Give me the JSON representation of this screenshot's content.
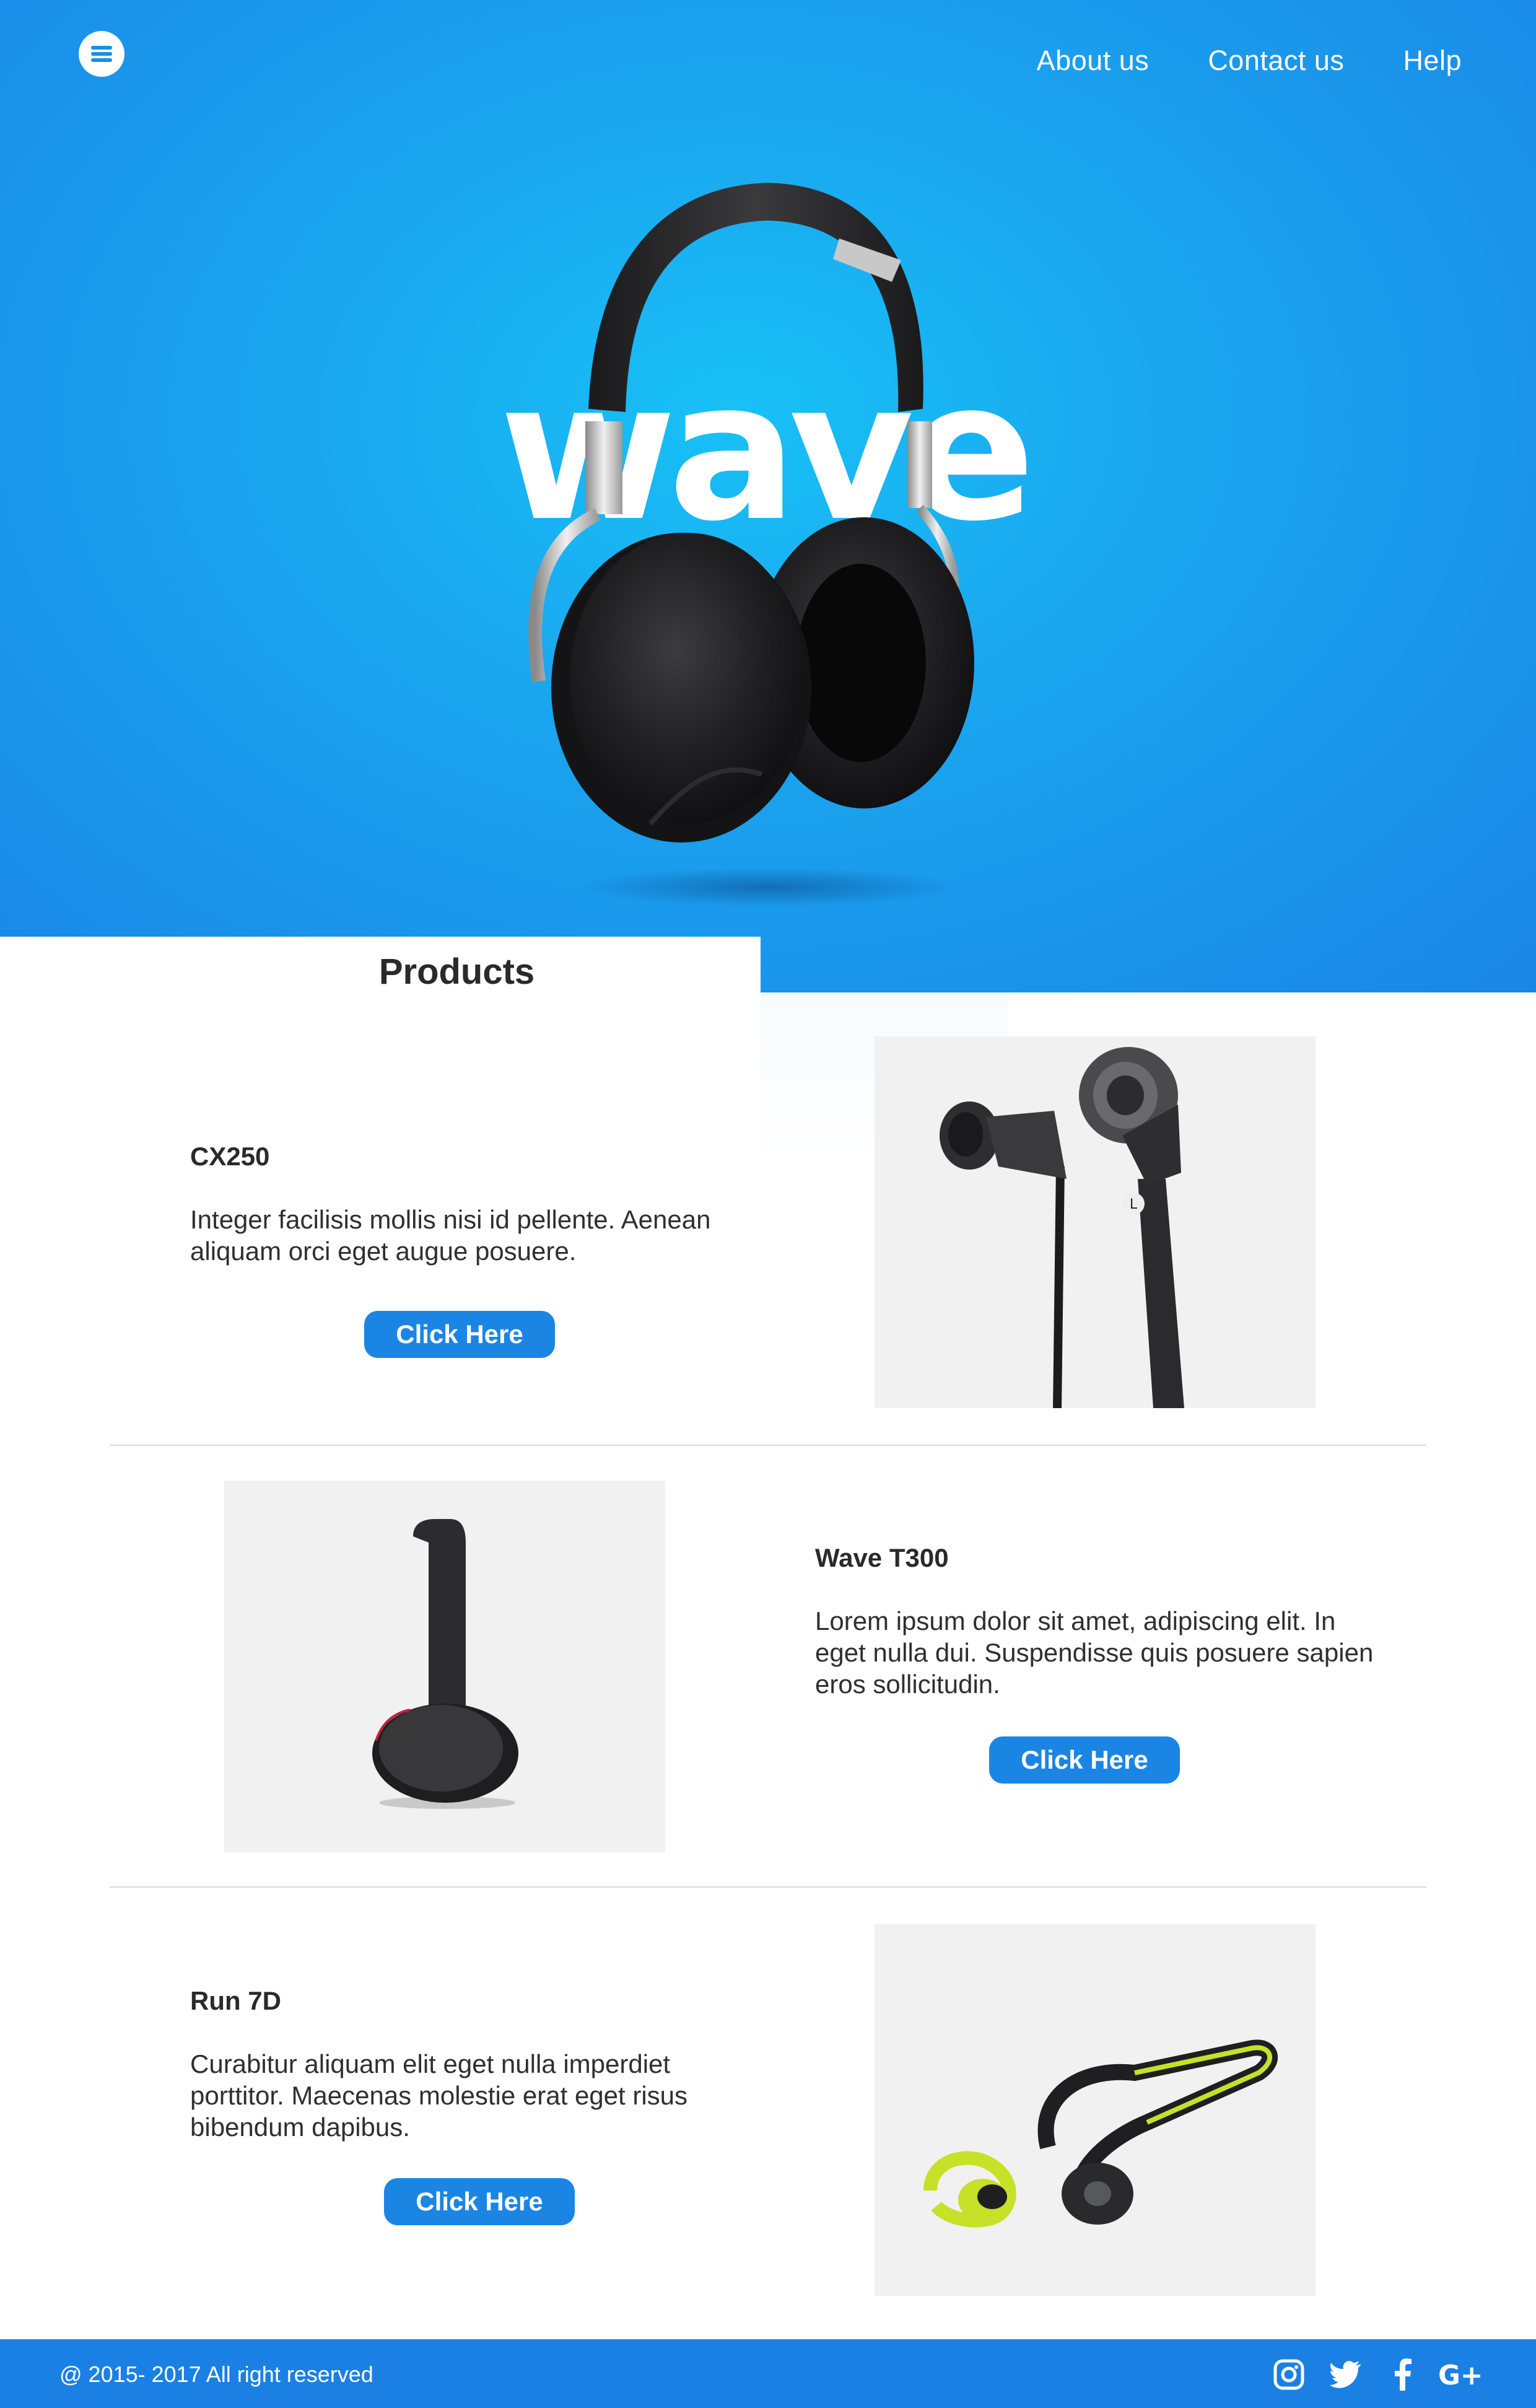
{
  "header": {
    "menu_icon": "hamburger-menu-icon",
    "nav": [
      {
        "label": "About us"
      },
      {
        "label": "Contact us"
      },
      {
        "label": "Help"
      }
    ]
  },
  "hero": {
    "brand_text": "wave",
    "image": "over-ear-headphones"
  },
  "products": {
    "title": "Products",
    "items": [
      {
        "name": "CX250",
        "description": "Integer facilisis mollis nisi id pellente. Aenean aliquam orci eget augue posuere.",
        "button_label": "Click Here",
        "image": "in-ear-earphones"
      },
      {
        "name": "Wave T300",
        "description": "Lorem ipsum dolor sit amet, adipiscing elit. In eget nulla dui. Suspendisse quis posuere sapien eros sollicitudin.",
        "button_label": "Click Here",
        "image": "on-ear-headphones-side"
      },
      {
        "name": "Run 7D",
        "description": "Curabitur aliquam elit eget nulla imperdiet porttitor. Maecenas molestie erat eget risus bibendum dapibus.",
        "button_label": "Click Here",
        "image": "sport-neckband-earphones"
      }
    ]
  },
  "footer": {
    "copyright": "@ 2015- 2017  All right reserved",
    "social": [
      "instagram-icon",
      "twitter-icon",
      "facebook-icon",
      "google-plus-icon"
    ]
  },
  "colors": {
    "accent": "#1b85e4",
    "hero_light": "#18c1f6",
    "hero_dark": "#1a85e6"
  }
}
